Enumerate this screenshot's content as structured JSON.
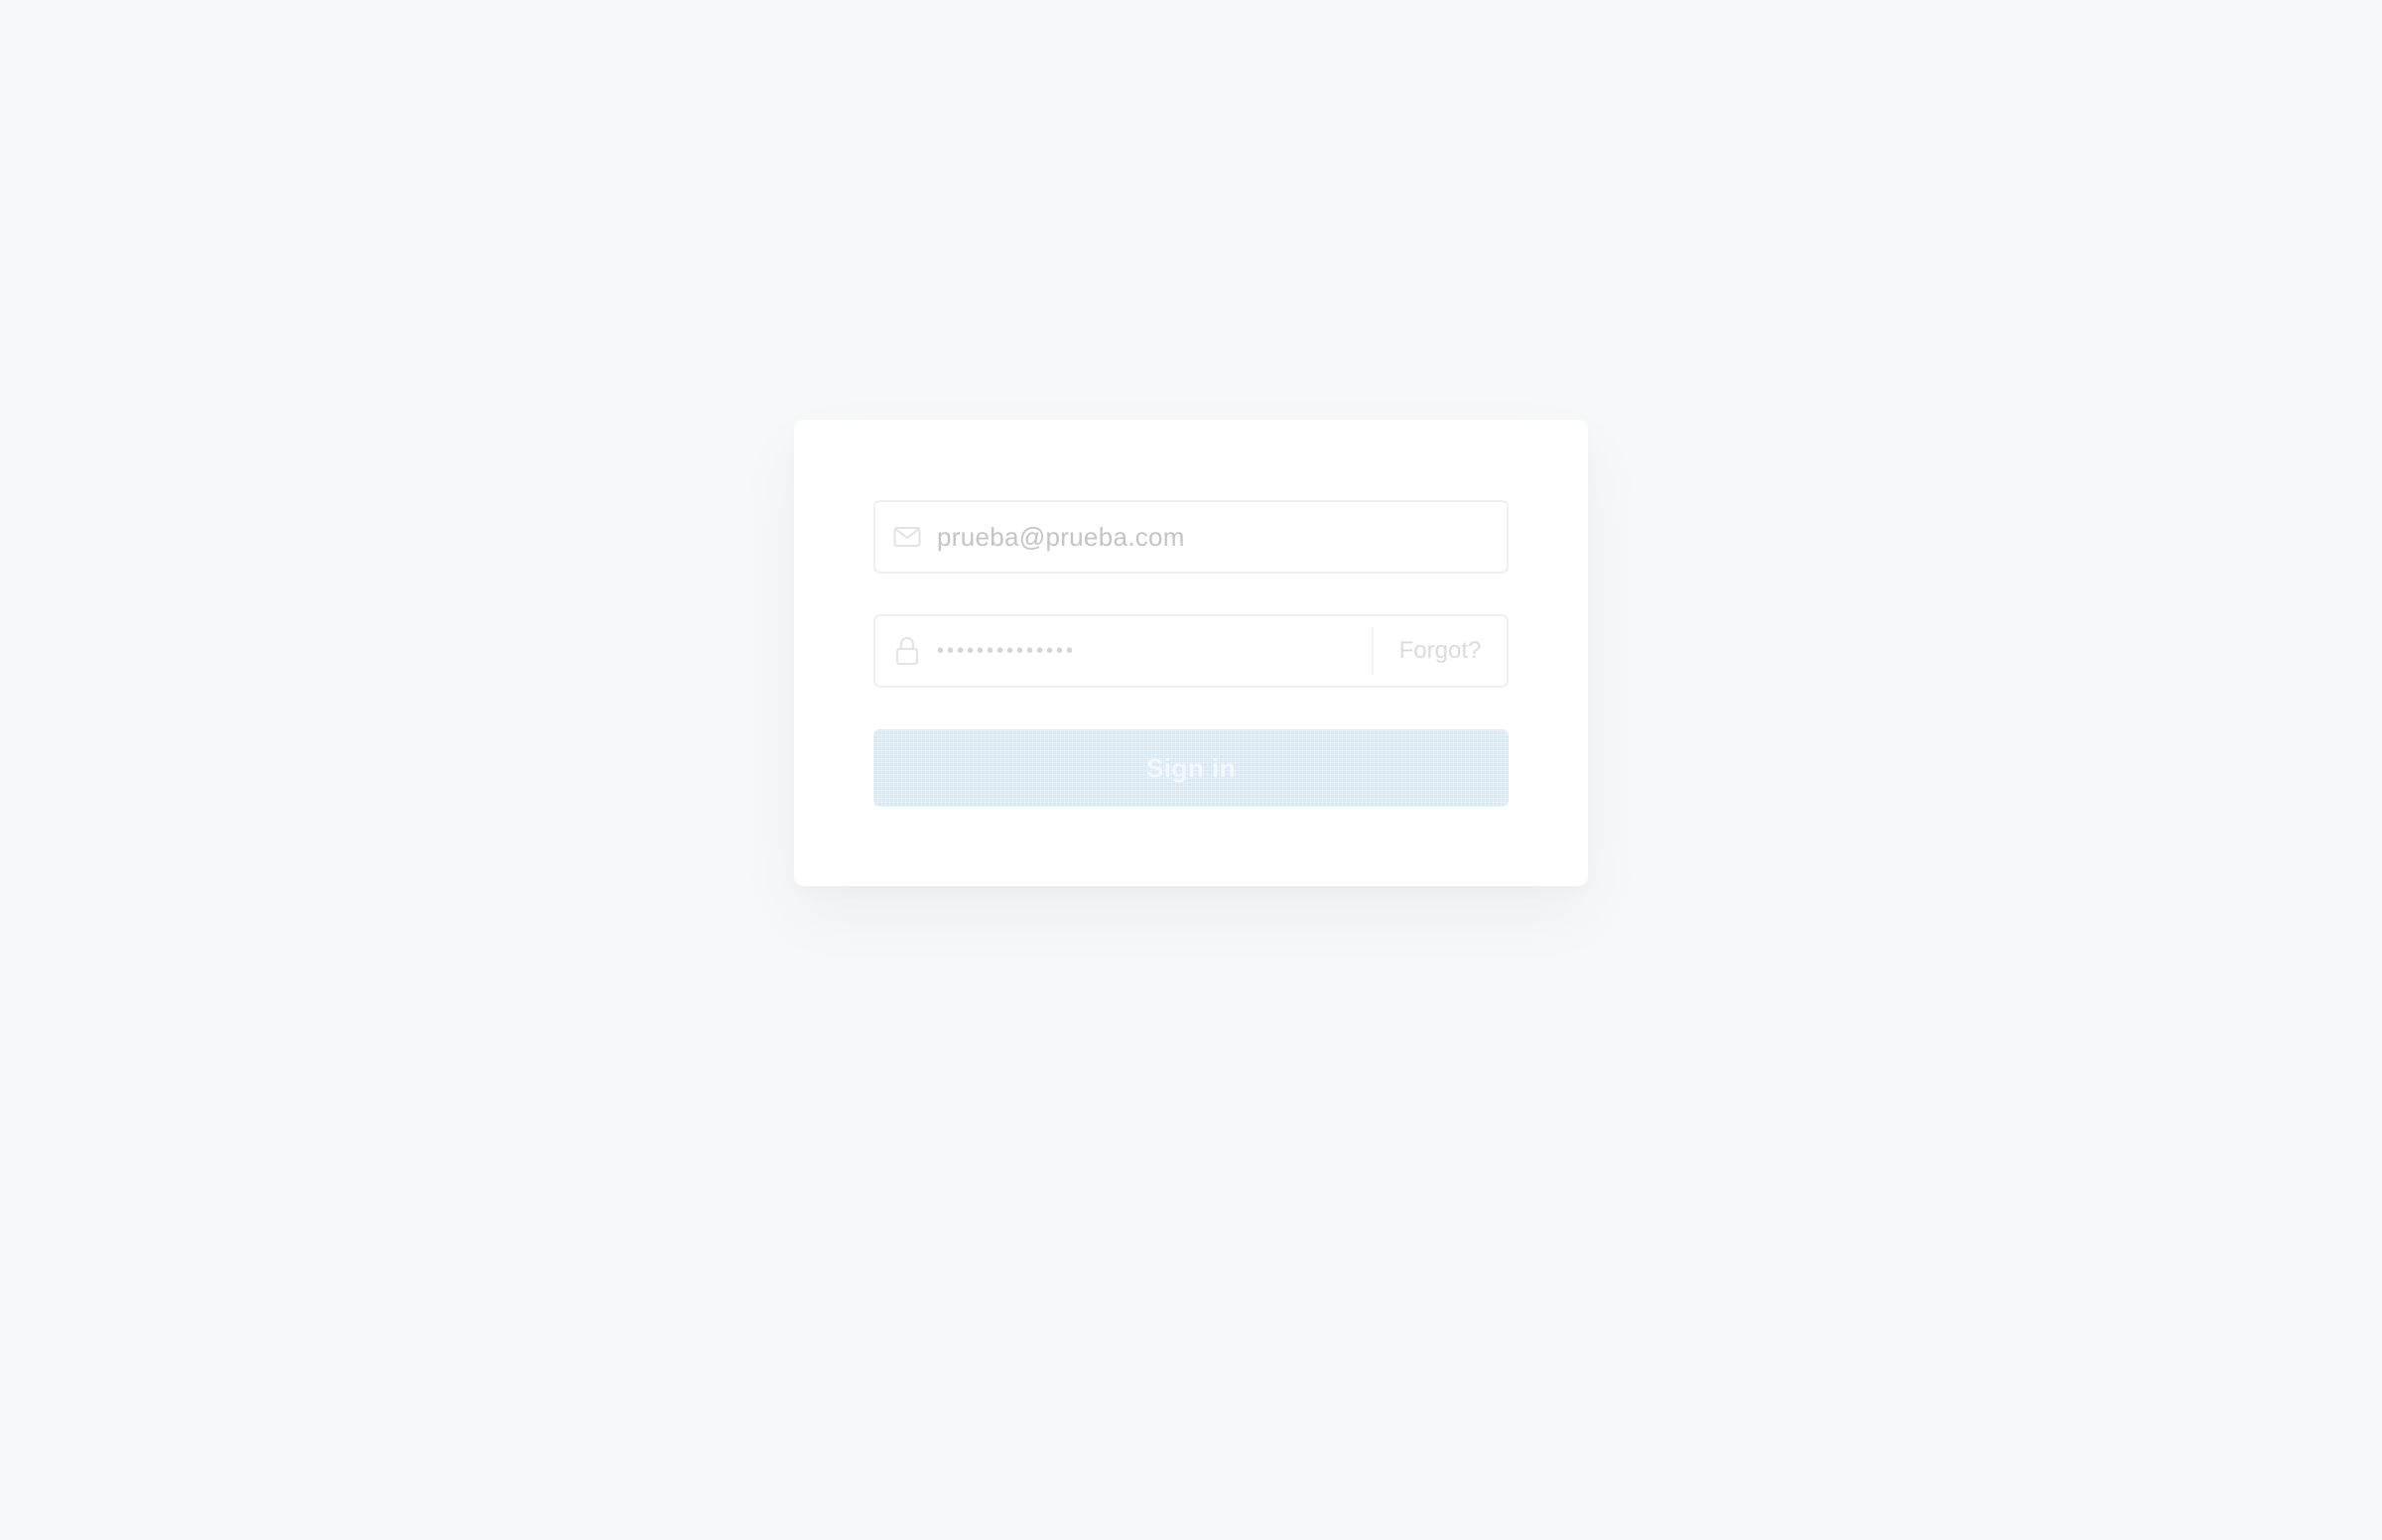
{
  "login": {
    "email_value": "prueba@prueba.com",
    "password_mask": "••••••••••••••",
    "forgot_label": "Forgot?",
    "submit_label": "Sign in"
  },
  "icons": {
    "email": "envelope-icon",
    "password": "lock-icon"
  },
  "colors": {
    "background": "#f7f8fa",
    "card": "#ffffff",
    "button": "#d6e9f8",
    "muted_text": "#c3c4c7"
  }
}
